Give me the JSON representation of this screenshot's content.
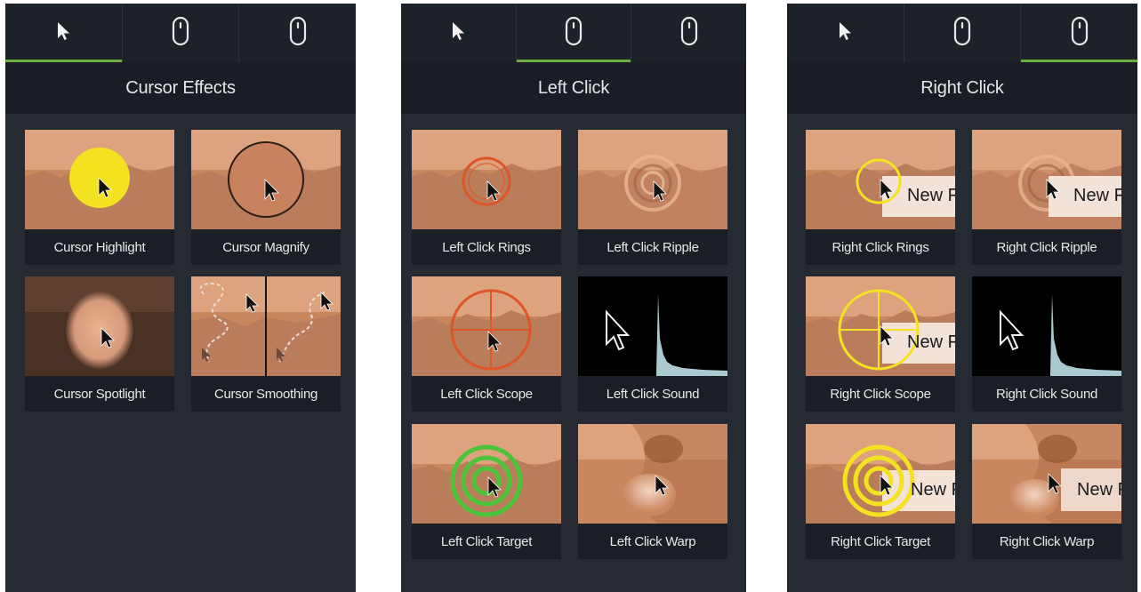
{
  "panels": [
    {
      "title": "Cursor Effects",
      "tabs": [
        "cursor-icon",
        "mouse-icon",
        "mouse-icon"
      ],
      "active_tab": 0,
      "items": [
        "Cursor Highlight",
        "Cursor Magnify",
        "Cursor Spotlight",
        "Cursor Smoothing"
      ]
    },
    {
      "title": "Left Click",
      "tabs": [
        "cursor-icon",
        "mouse-left-icon",
        "mouse-right-icon"
      ],
      "active_tab": 1,
      "items": [
        "Left Click Rings",
        "Left Click Ripple",
        "Left Click Scope",
        "Left Click Sound",
        "Left Click Target",
        "Left Click Warp"
      ]
    },
    {
      "title": "Right Click",
      "tabs": [
        "cursor-icon",
        "mouse-left-icon",
        "mouse-right-icon"
      ],
      "active_tab": 2,
      "items": [
        "Right Click Rings",
        "Right Click Ripple",
        "Right Click Scope",
        "Right Click Sound",
        "Right Click Target",
        "Right Click Warp"
      ],
      "menu_text": "New F"
    }
  ],
  "colors": {
    "panel_bg": "#262b33",
    "tab_bg": "#1d2128",
    "title_bg": "#1a1e24",
    "active_tab_accent": "#6cae45",
    "highlight_yellow": "#f3e21f",
    "click_orange": "#e0542a",
    "target_green": "#4cc43a",
    "sound_wave": "#a9c8cf"
  }
}
